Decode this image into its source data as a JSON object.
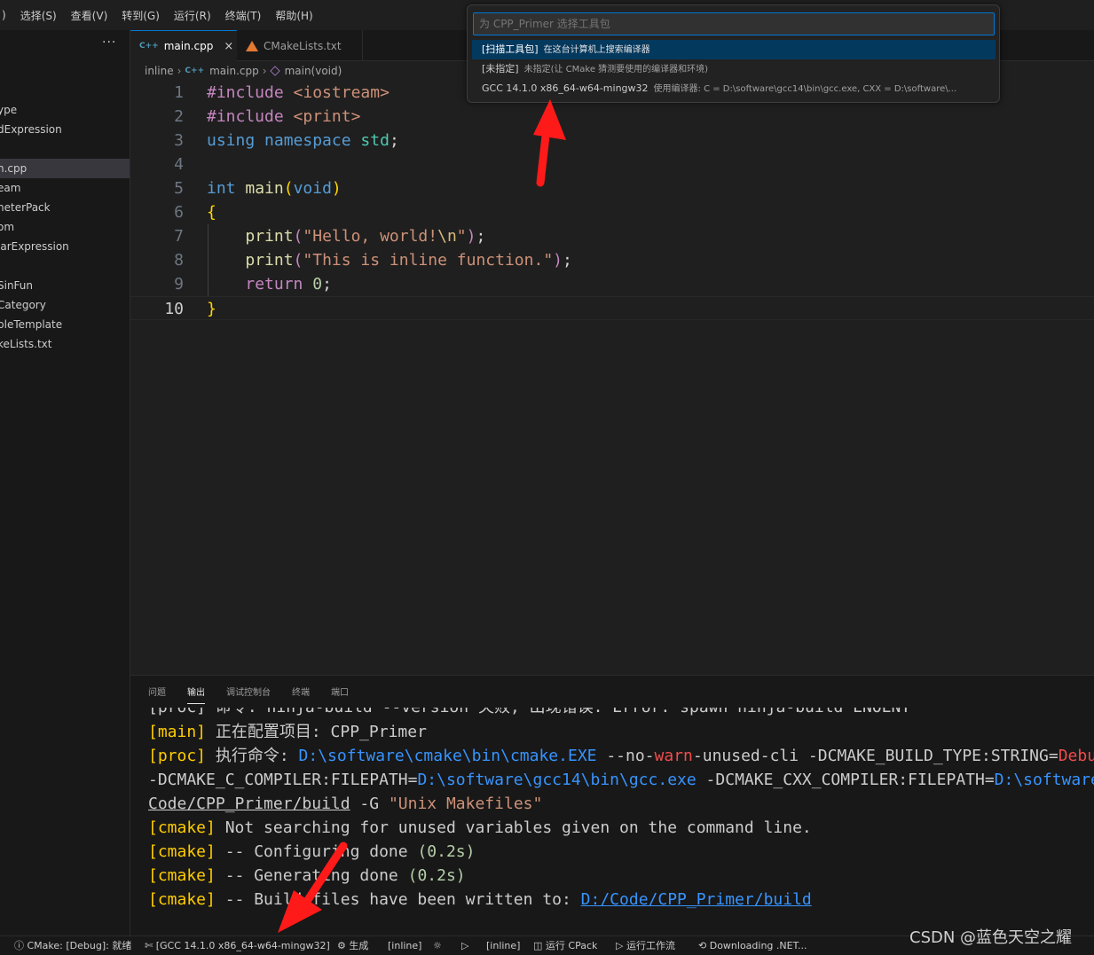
{
  "menubar": {
    "items": [
      ")",
      "选择(S)",
      "查看(V)",
      "转到(G)",
      "运行(R)",
      "终端(T)",
      "帮助(H)"
    ]
  },
  "sidebar": {
    "more": "···",
    "items": [
      "ype",
      "dExpression",
      "n.cpp",
      "eam",
      "neterPack",
      "om",
      "larExpression",
      "",
      "SinFun",
      "Category",
      "pleTemplate",
      "keLists.txt"
    ]
  },
  "tabs": [
    {
      "label": "main.cpp",
      "icon": "cpp-icon",
      "close": "×"
    },
    {
      "label": "CMakeLists.txt",
      "icon": "cmake-icon"
    }
  ],
  "breadcrumb": {
    "folder": "inline",
    "file": "main.cpp",
    "symbol": "main(void)"
  },
  "editor": {
    "lines": [
      "#include <iostream>",
      "#include <print>",
      "using namespace std;",
      "",
      "int main(void)",
      "{",
      "    print(\"Hello, world!\\n\");",
      "    print(\"This is inline function.\");",
      "    return 0;",
      "}"
    ],
    "line_numbers": [
      "1",
      "2",
      "3",
      "4",
      "5",
      "6",
      "7",
      "8",
      "9",
      "10"
    ],
    "current_line": 10
  },
  "palette": {
    "placeholder": "为 CPP_Primer 选择工具包",
    "items": [
      {
        "label": "[扫描工具包]",
        "detail": "在这台计算机上搜索编译器"
      },
      {
        "label": "[未指定]",
        "detail": "未指定(让 CMake 猜测要使用的编译器和环境)"
      },
      {
        "label": "GCC 14.1.0 x86_64-w64-mingw32",
        "detail": "使用编译器: C = D:\\software\\gcc14\\bin\\gcc.exe, CXX = D:\\software\\..."
      }
    ]
  },
  "panel": {
    "tabs": [
      "问题",
      "输出",
      "调试控制台",
      "终端",
      "端口"
    ],
    "active_tab": "输出",
    "output": {
      "l0": "[proc] 命令: ninja-build --version 失败, 出现错误: Error: spawn ninja-build ENOENT",
      "l1a": "[main]",
      "l1b": " 正在配置项目: CPP_Primer",
      "l2a": "[proc]",
      "l2b": " 执行命令: ",
      "l2c": "D:\\software\\cmake\\bin\\cmake.EXE",
      "l2d": " --no-",
      "l2e": "warn",
      "l2f": "-unused-cli -DCMAKE_BUILD_TYPE:STRING=",
      "l2g": "Debug",
      "l3a": "-DCMAKE_C_COMPILER:FILEPATH=",
      "l3b": "D:\\software\\gcc14\\bin\\gcc.exe",
      "l3c": " -DCMAKE_CXX_COMPILER:FILEPATH=",
      "l3d": "D:\\software",
      "l4a": "Code/CPP_Primer/build",
      "l4b": " -G ",
      "l4c": "\"Unix Makefiles\"",
      "l5a": "[cmake]",
      "l5b": " Not searching for unused variables given on the command line.",
      "l6a": "[cmake]",
      "l6b": " -- Configuring done ",
      "l6c": "(0.2s)",
      "l7a": "[cmake]",
      "l7b": " -- Generating done ",
      "l7c": "(0.2s)",
      "l8a": "[cmake]",
      "l8b": " -- Build files have been written to: ",
      "l8c": "D:/Code/CPP_Primer/build"
    }
  },
  "statusbar": {
    "cmake_status": "CMake: [Debug]: 就绪",
    "kit": "[GCC 14.1.0 x86_64-w64-mingw32]",
    "build": "生成",
    "target1": "[inline]",
    "target2": "[inline]",
    "cpack": "运行 CPack",
    "workflow": "运行工作流",
    "downloading": "Downloading .NET..."
  },
  "watermark": "CSDN @蓝色天空之耀",
  "colors": {
    "accent": "#0078d4",
    "arrow": "#ff1a1a",
    "selection": "#04395e"
  }
}
